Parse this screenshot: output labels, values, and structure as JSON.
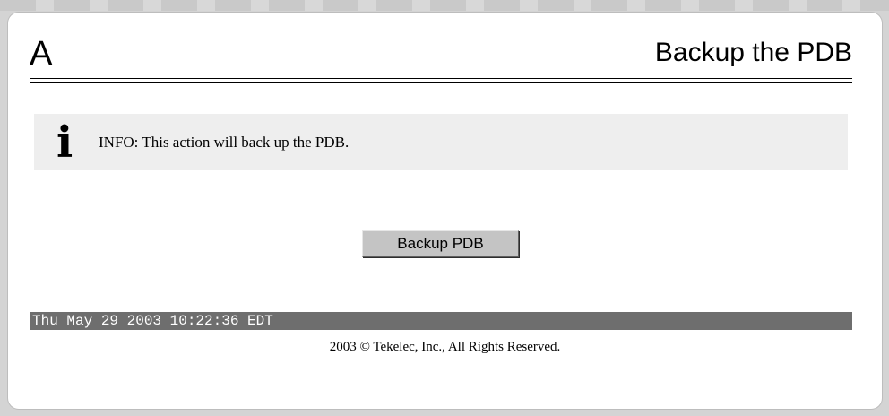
{
  "header": {
    "letter": "A",
    "title": "Backup the PDB"
  },
  "info": {
    "icon": "info-icon",
    "text": "INFO: This action will back up the PDB."
  },
  "actions": {
    "backup_label": "Backup PDB"
  },
  "status": {
    "datetime": "Thu May 29 2003 10:22:36 EDT"
  },
  "footer": {
    "copyright": "2003 © Tekelec, Inc., All Rights Reserved."
  },
  "colors": {
    "panel_background": "#ffffff",
    "page_background": "#d4d4d4",
    "info_background": "#eeeeee",
    "status_bar": "#6e6e6e",
    "button_face": "#c4c4c4"
  }
}
